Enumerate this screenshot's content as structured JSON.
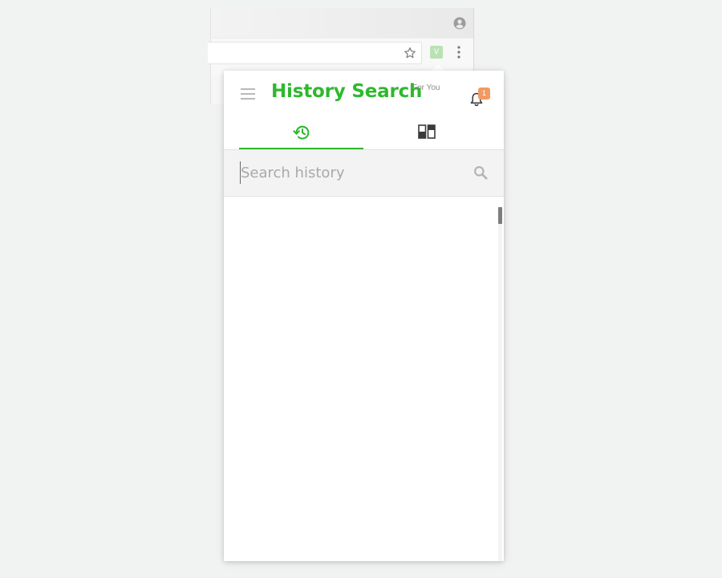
{
  "browser": {
    "extension_label": "V",
    "icons": [
      "account-icon",
      "star-icon",
      "kebab-menu-icon"
    ]
  },
  "popup": {
    "title": "History Search",
    "subtitle": "For You",
    "notification_count": "1",
    "accent_color": "#2fb82f",
    "badge_color": "#f19a63",
    "tabs": [
      {
        "name": "history",
        "icon": "history-clock-icon",
        "active": true
      },
      {
        "name": "split-view",
        "icon": "split-view-icon",
        "active": false
      }
    ],
    "search": {
      "placeholder": "Search history",
      "value": ""
    },
    "results": []
  }
}
